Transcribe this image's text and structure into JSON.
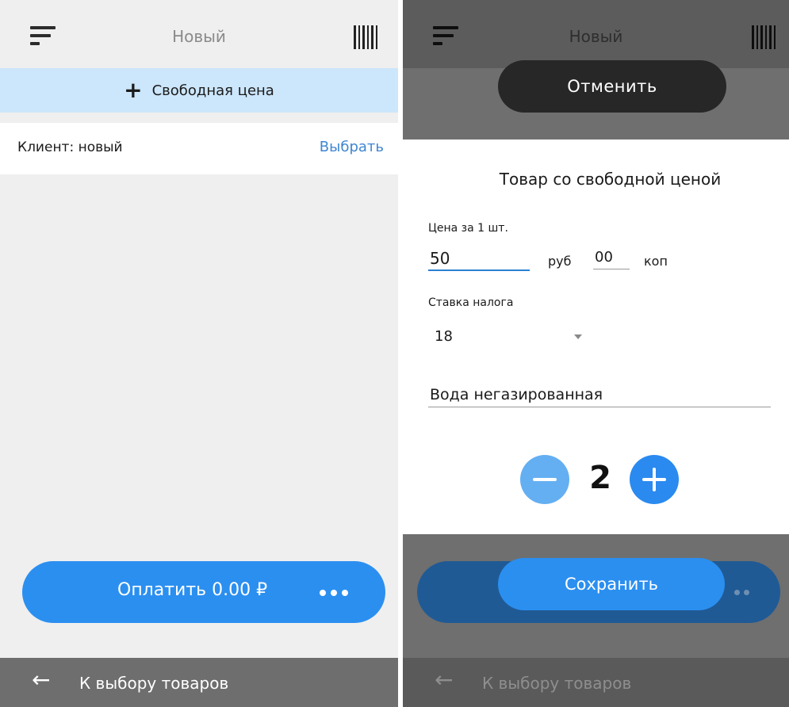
{
  "left_screen": {
    "header": {
      "title": "Новый",
      "menu_icon": "hamburger-icon",
      "barcode_icon": "barcode-icon"
    },
    "free_price": {
      "label": "Свободная цена",
      "icon": "plus-icon"
    },
    "client": {
      "label": "Клиент: новый",
      "action": "Выбрать"
    },
    "pay": {
      "label": "Оплатить  0.00 ₽",
      "more_icon": "more-dots-icon"
    },
    "bottom": {
      "label": "К выбору товаров",
      "icon": "arrow-left-icon"
    }
  },
  "right_screen": {
    "header": {
      "title": "Новый",
      "menu_icon": "hamburger-icon",
      "barcode_icon": "barcode-icon"
    },
    "cancel": {
      "label": "Отменить"
    },
    "dialog": {
      "title": "Товар со свободной ценой",
      "price_label": "Цена за 1 шт.",
      "price_rub": "50",
      "rub_unit": "руб",
      "price_kop": "00",
      "kop_unit": "коп",
      "tax_label": "Ставка налога",
      "tax_value": "18",
      "product_name": "Вода негазированная",
      "quantity": "2"
    },
    "save": {
      "label": "Сохранить"
    },
    "bottom": {
      "label": "К выбору товаров",
      "icon": "arrow-left-icon"
    }
  },
  "colors": {
    "accent": "#2b8ff0",
    "link": "#3f86d1",
    "free_price_bg": "#cce6fb",
    "overlay_dark": "#272727"
  }
}
